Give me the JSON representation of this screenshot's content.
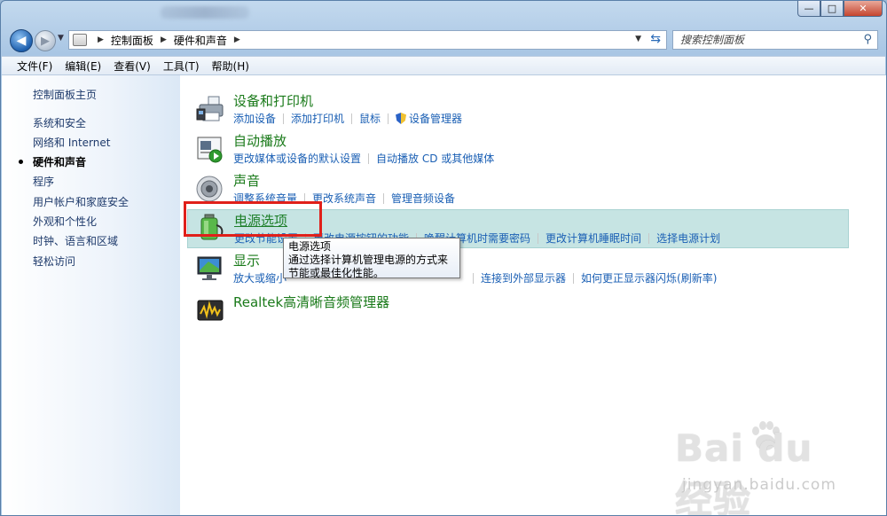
{
  "window": {
    "controls": {
      "minimize": "—",
      "maximize": "□",
      "close": "✕"
    }
  },
  "navigation": {
    "back_icon": "back-arrow-icon",
    "forward_icon": "forward-arrow-icon",
    "breadcrumbs": [
      "控制面板",
      "硬件和声音"
    ],
    "search_placeholder": "搜索控制面板"
  },
  "menu": [
    "文件(F)",
    "编辑(E)",
    "查看(V)",
    "工具(T)",
    "帮助(H)"
  ],
  "sidebar": {
    "home": "控制面板主页",
    "items": [
      {
        "label": "系统和安全",
        "current": false
      },
      {
        "label": "网络和 Internet",
        "current": false
      },
      {
        "label": "硬件和声音",
        "current": true
      },
      {
        "label": "程序",
        "current": false
      },
      {
        "label": "用户帐户和家庭安全",
        "current": false
      },
      {
        "label": "外观和个性化",
        "current": false
      },
      {
        "label": "时钟、语言和区域",
        "current": false
      },
      {
        "label": "轻松访问",
        "current": false
      }
    ]
  },
  "categories": [
    {
      "title": "设备和打印机",
      "icon": "printer-icon",
      "links": [
        "添加设备",
        "添加打印机",
        "鼠标",
        "设备管理器"
      ]
    },
    {
      "title": "自动播放",
      "icon": "autoplay-icon",
      "links": [
        "更改媒体或设备的默认设置",
        "自动播放 CD 或其他媒体"
      ]
    },
    {
      "title": "声音",
      "icon": "speaker-icon",
      "links": [
        "调整系统音量",
        "更改系统声音",
        "管理音频设备"
      ]
    },
    {
      "title": "电源选项",
      "icon": "battery-icon",
      "links": [
        "更改节能设置",
        "更改电源按钮的功能",
        "唤醒计算机时需要密码",
        "更改计算机睡眠时间",
        "选择电源计划"
      ]
    },
    {
      "title": "显示",
      "icon": "display-icon",
      "links": [
        "放大或缩小",
        "连接到外部显示器",
        "如何更正显示器闪烁(刷新率)"
      ]
    },
    {
      "title": "Realtek高清晰音频管理器",
      "icon": "realtek-audio-icon",
      "links": []
    }
  ],
  "tooltip": {
    "title": "电源选项",
    "body": "通过选择计算机管理电源的方式来节能或最佳化性能。"
  },
  "watermark": {
    "logo": "Bai du 经验",
    "url": "jingyan.baidu.com"
  },
  "colors": {
    "link": "#1a5fb4",
    "category_title": "#1a7a1a",
    "hover_bg": "#c6e4e3",
    "highlight_box": "#e0201a"
  }
}
